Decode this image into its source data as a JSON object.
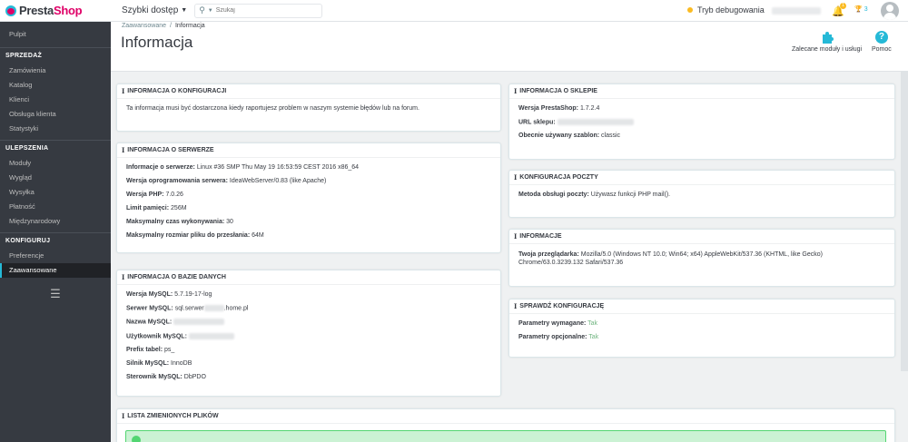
{
  "header": {
    "logo_pre": "Presta",
    "logo_post": "Shop",
    "quick_access": "Szybki dostęp",
    "search_placeholder": "Szukaj",
    "debug_mode": "Tryb debugowania",
    "notifications_count": "1",
    "trophy_count": "3"
  },
  "sidebar": {
    "dashboard": "Pulpit",
    "sections": [
      {
        "title": "SPRZEDAŻ",
        "items": [
          "Zamówienia",
          "Katalog",
          "Klienci",
          "Obsługa klienta",
          "Statystyki"
        ]
      },
      {
        "title": "ULEPSZENIA",
        "items": [
          "Moduły",
          "Wygląd",
          "Wysyłka",
          "Płatność",
          "Międzynarodowy"
        ]
      },
      {
        "title": "KONFIGURUJ",
        "items": [
          "Preferencje",
          "Zaawansowane"
        ]
      }
    ],
    "active_item": "Zaawansowane"
  },
  "page": {
    "breadcrumb_parent": "Zaawansowane",
    "breadcrumb_current": "Informacja",
    "title": "Informacja",
    "toolbar_modules": "Zalecane moduły i usługi",
    "toolbar_help": "Pomoc"
  },
  "panels": {
    "config_info": {
      "title": "INFORMACJA O KONFIGURACJI",
      "text": "Ta informacja musi być dostarczona kiedy raportujesz problem w naszym systemie błędów lub na forum."
    },
    "server_info": {
      "title": "INFORMACJA O SERWERZE",
      "rows": [
        {
          "label": "Informacje o serwerze:",
          "value": "Linux #36 SMP Thu May 19 16:53:59 CEST 2016 x86_64"
        },
        {
          "label": "Wersja oprogramowania serwera:",
          "value": "IdeaWebServer/0.83 (like Apache)"
        },
        {
          "label": "Wersja PHP:",
          "value": "7.0.26"
        },
        {
          "label": "Limit pamięci:",
          "value": "256M"
        },
        {
          "label": "Maksymalny czas wykonywania:",
          "value": "30"
        },
        {
          "label": "Maksymalny rozmiar pliku do przesłania:",
          "value": "64M"
        }
      ]
    },
    "db_info": {
      "title": "INFORMACJA O BAZIE DANYCH",
      "rows": [
        {
          "label": "Wersja MySQL:",
          "value": "5.7.19-17-log"
        },
        {
          "label": "Serwer MySQL:",
          "value_pre": "sql.serwer",
          "value_post": ".home.pl"
        },
        {
          "label": "Nazwa MySQL:",
          "value": ""
        },
        {
          "label": "Użytkownik MySQL:",
          "value": ""
        },
        {
          "label": "Prefix tabel:",
          "value": "ps_"
        },
        {
          "label": "Silnik MySQL:",
          "value": "InnoDB"
        },
        {
          "label": "Sterownik MySQL:",
          "value": "DbPDO"
        }
      ]
    },
    "shop_info": {
      "title": "INFORMACJA O SKLEPIE",
      "rows": [
        {
          "label": "Wersja PrestaShop:",
          "value": "1.7.2.4"
        },
        {
          "label": "URL sklepu:",
          "value": ""
        },
        {
          "label": "Obecnie używany szablon:",
          "value": "classic"
        }
      ]
    },
    "mail_config": {
      "title": "KONFIGURACJA POCZTY",
      "label": "Metoda obsługi poczty:",
      "value": "Używasz funkcji PHP mail()."
    },
    "info": {
      "title": "INFORMACJE",
      "label": "Twoja przeglądarka:",
      "value_line1": "Mozilla/5.0 (Windows NT 10.0; Win64; x64) AppleWebKit/537.36 (KHTML, like Gecko)",
      "value_line2": "Chrome/63.0.3239.132 Safari/537.36"
    },
    "check_config": {
      "title": "SPRAWDŹ KONFIGURACJĘ",
      "rows": [
        {
          "label": "Parametry wymagane:",
          "value": "Tak"
        },
        {
          "label": "Parametry opcjonalne:",
          "value": "Tak"
        }
      ]
    },
    "changed_files": {
      "title": "LISTA ZMIENIONYCH PLIKÓW"
    }
  },
  "colors": {
    "accent": "#25b9d7",
    "sidebar_bg": "#363a41",
    "success": "#70b580",
    "debug_dot": "#fbbb22"
  }
}
